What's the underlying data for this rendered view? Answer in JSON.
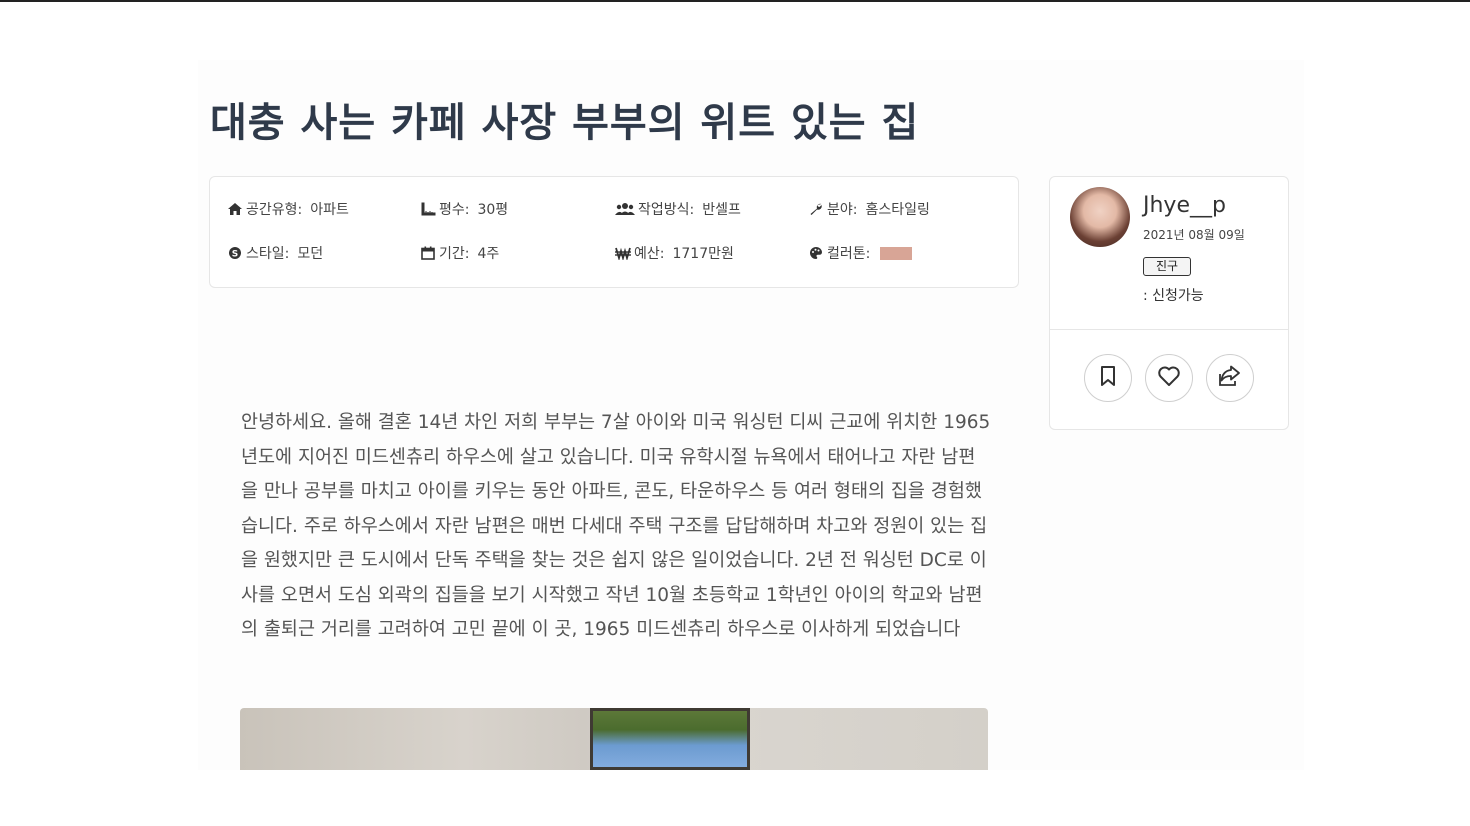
{
  "title": "대충 사는 카페 사장 부부의 위트 있는 집",
  "info": {
    "space_type": {
      "label": "공간유형:",
      "value": "아파트",
      "icon": "home-icon"
    },
    "size": {
      "label": "평수:",
      "value": "30평",
      "icon": "ruler-icon"
    },
    "work_method": {
      "label": "작업방식:",
      "value": "반셀프",
      "icon": "users-icon"
    },
    "field": {
      "label": "분야:",
      "value": "홈스타일링",
      "icon": "wrench-icon"
    },
    "style": {
      "label": "스타일:",
      "value": "모던",
      "icon": "skype-icon"
    },
    "period": {
      "label": "기간:",
      "value": "4주",
      "icon": "calendar-icon"
    },
    "budget": {
      "label": "예산:",
      "value": "1717만원",
      "icon": "won-icon"
    },
    "color_tone": {
      "label": "컬러톤:",
      "color": "#d8a596",
      "icon": "palette-icon"
    }
  },
  "content": {
    "paragraph": "안녕하세요. 올해 결혼 14년 차인 저희 부부는 7살 아이와 미국 워싱턴 디씨 근교에 위치한 1965년도에 지어진 미드센츄리 하우스에 살고 있습니다. 미국 유학시절 뉴욕에서 태어나고 자란 남편을 만나 공부를 마치고 아이를 키우는 동안 아파트, 콘도, 타운하우스 등 여러 형태의 집을 경험했습니다. 주로 하우스에서 자란 남편은 매번 다세대 주택 구조를 답답해하며 차고와 정원이 있는 집을 원했지만 큰 도시에서 단독 주택을 찾는 것은 쉽지 않은 일이었습니다. 2년 전 워싱턴 DC로 이사를 오면서 도심 외곽의 집들을 보기 시작했고 작년 10월 초등학교 1학년인 아이의 학교와 남편의 출퇴근 거리를 고려하여 고민 끝에 이 곳, 1965 미드센츄리 하우스로 이사하게 되었습니다"
  },
  "author": {
    "username": "Jhye__p",
    "join_date": "2021년 08월 09일",
    "badge": "진구",
    "status": ": 신청가능"
  },
  "actions": {
    "bookmark_icon": "bookmark-icon",
    "like_icon": "heart-icon",
    "share_icon": "share-icon"
  }
}
